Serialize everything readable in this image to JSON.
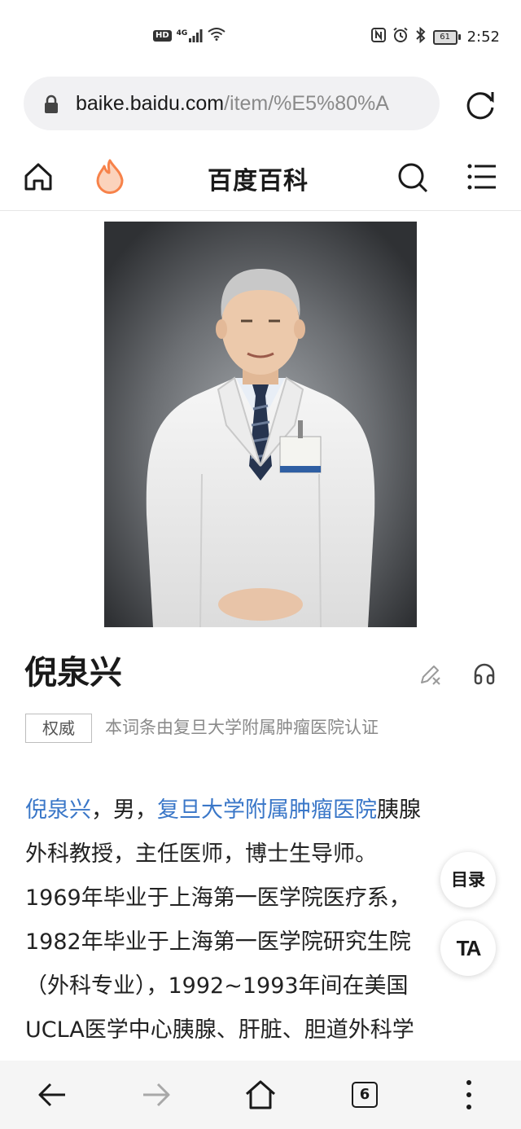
{
  "status_bar": {
    "network_badge": "HD",
    "network_type": "4G",
    "time": "2:52",
    "battery": "61",
    "icons": [
      "hd-icon",
      "signal-icon",
      "wifi-icon",
      "nfc-icon",
      "alarm-icon",
      "bluetooth-icon",
      "battery-icon"
    ]
  },
  "url_bar": {
    "domain": "baike.baidu.com",
    "path": "/item/%E5%80%A",
    "icons": [
      "lock-icon",
      "reload-icon"
    ]
  },
  "header": {
    "title": "百度百科",
    "icons": [
      "home-icon",
      "flame-icon",
      "search-icon",
      "menu-icon"
    ],
    "accent": "#f7824a"
  },
  "entry": {
    "title": "倪泉兴",
    "auth_badge": "权威",
    "auth_text": "本词条由复旦大学附属肿瘤医院认证",
    "summary": {
      "name_link": "倪泉兴",
      "gender": "，男，",
      "hospital_link": "复旦大学附属肿瘤医院",
      "line1_tail": "胰腺",
      "line2": "外科教授，主任医师，博士生导师。",
      "line3": "1969年毕业于上海第一医学院医疗系，",
      "line4": "1982年毕业于上海第一医学院研究生院",
      "line5": "（外科专业），1992~1993年间在美国",
      "line6": "UCLA医学中心胰腺、肝脏、胆道外科学"
    },
    "link_color": "#3a77c8"
  },
  "floating": {
    "toc_label": "目录",
    "ta_label": "TA"
  },
  "bottom_bar": {
    "tab_count": "6",
    "icons": [
      "back-arrow-icon",
      "forward-arrow-icon",
      "home-icon",
      "tabs-icon",
      "more-icon"
    ]
  }
}
